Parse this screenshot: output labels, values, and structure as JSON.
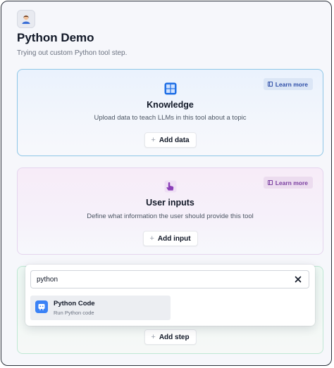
{
  "app": {
    "icon": "user-avatar-icon",
    "title": "Python Demo",
    "subtitle": "Trying out custom Python tool step."
  },
  "knowledge": {
    "icon": "windows-grid-icon",
    "title": "Knowledge",
    "description": "Upload data to teach LLMs in this tool about a topic",
    "learn_more": "Learn more",
    "button": "Add data",
    "accent": "#2f4fa8"
  },
  "user_inputs": {
    "icon": "hand-pointer-icon",
    "title": "User inputs",
    "description": "Define what information the user should provide this tool",
    "learn_more": "Learn more",
    "button": "Add input",
    "accent": "#7a3ea0"
  },
  "steps": {
    "button": "Add step"
  },
  "search": {
    "value": "python",
    "clear_icon": "close-icon",
    "results": [
      {
        "icon": "python-code-icon",
        "title": "Python Code",
        "subtitle": "Run Python code"
      }
    ]
  }
}
